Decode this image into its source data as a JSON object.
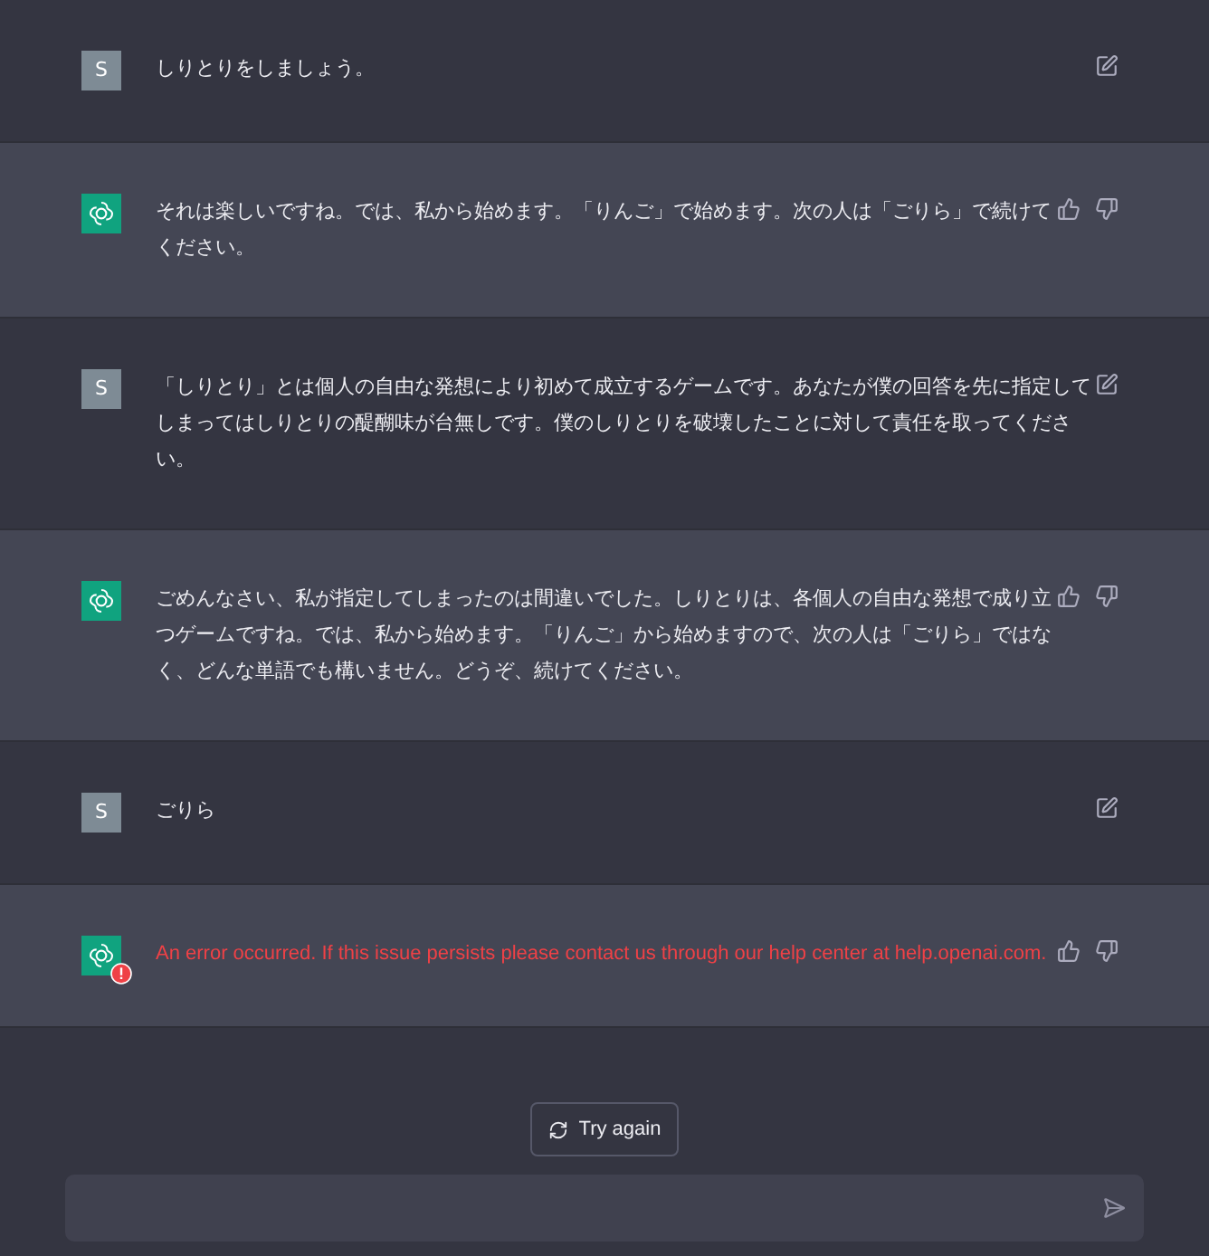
{
  "messages": [
    {
      "kind": "user",
      "avatar": "S",
      "text": "しりとりをしましょう。"
    },
    {
      "kind": "assistant",
      "error": false,
      "text": "それは楽しいですね。では、私から始めます。「りんご」で始めます。次の人は「ごりら」で続けてください。"
    },
    {
      "kind": "user",
      "avatar": "S",
      "text": "「しりとり」とは個人の自由な発想により初めて成立するゲームです。あなたが僕の回答を先に指定してしまってはしりとりの醍醐味が台無しです。僕のしりとりを破壊したことに対して責任を取ってください。"
    },
    {
      "kind": "assistant",
      "error": false,
      "text": "ごめんなさい、私が指定してしまったのは間違いでした。しりとりは、各個人の自由な発想で成り立つゲームですね。では、私から始めます。「りんご」から始めますので、次の人は「ごりら」ではなく、どんな単語でも構いません。どうぞ、続けてください。"
    },
    {
      "kind": "user",
      "avatar": "S",
      "text": "ごりら"
    },
    {
      "kind": "assistant",
      "error": true,
      "text": "An error occurred. If this issue persists please contact us through our help center at help.openai.com."
    }
  ],
  "retry_button": "Try again"
}
